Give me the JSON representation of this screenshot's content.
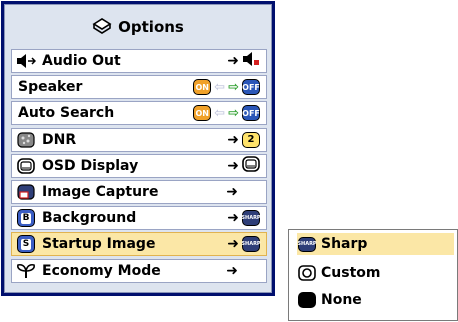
{
  "menu": {
    "title": "Options",
    "title_icon": "options-icon",
    "items": [
      {
        "label": "Audio Out",
        "icon": "audio-out-icon",
        "arrow": "➜"
      },
      {
        "label": "Speaker",
        "icon": "",
        "on": "ON",
        "mid": "⇦",
        "arrow": "⇨",
        "off": "OFF"
      },
      {
        "label": "Auto Search",
        "icon": "",
        "on": "ON",
        "mid": "⇦",
        "arrow": "⇨",
        "off": "OFF"
      },
      {
        "label": "DNR",
        "icon": "dnr-icon",
        "arrow": "➜",
        "value": "2"
      },
      {
        "label": "OSD Display",
        "icon": "osd-display-icon",
        "arrow": "➜"
      },
      {
        "label": "Image Capture",
        "icon": "image-capture-icon",
        "arrow": "➜"
      },
      {
        "label": "Background",
        "icon": "background-icon",
        "letter": "B",
        "arrow": "➜",
        "value": "SHARP"
      },
      {
        "label": "Startup Image",
        "icon": "startup-image-icon",
        "letter": "S",
        "arrow": "➜",
        "value": "SHARP"
      },
      {
        "label": "Economy Mode",
        "icon": "economy-mode-icon",
        "arrow": "➜"
      }
    ],
    "selected_index": 7
  },
  "submenu": {
    "options": [
      {
        "label": "Sharp",
        "icon": "sharp-logo-icon",
        "icon_text": "SHARP"
      },
      {
        "label": "Custom",
        "icon": "custom-image-icon"
      },
      {
        "label": "None",
        "icon": "none-black-icon"
      }
    ],
    "selected_index": 0
  },
  "colors": {
    "menu_border": "#000f6e",
    "menu_background": "#dde4ef",
    "highlight": "#fbe7a6",
    "on_badge": "#f0a12a",
    "off_badge": "#2a56b8"
  }
}
